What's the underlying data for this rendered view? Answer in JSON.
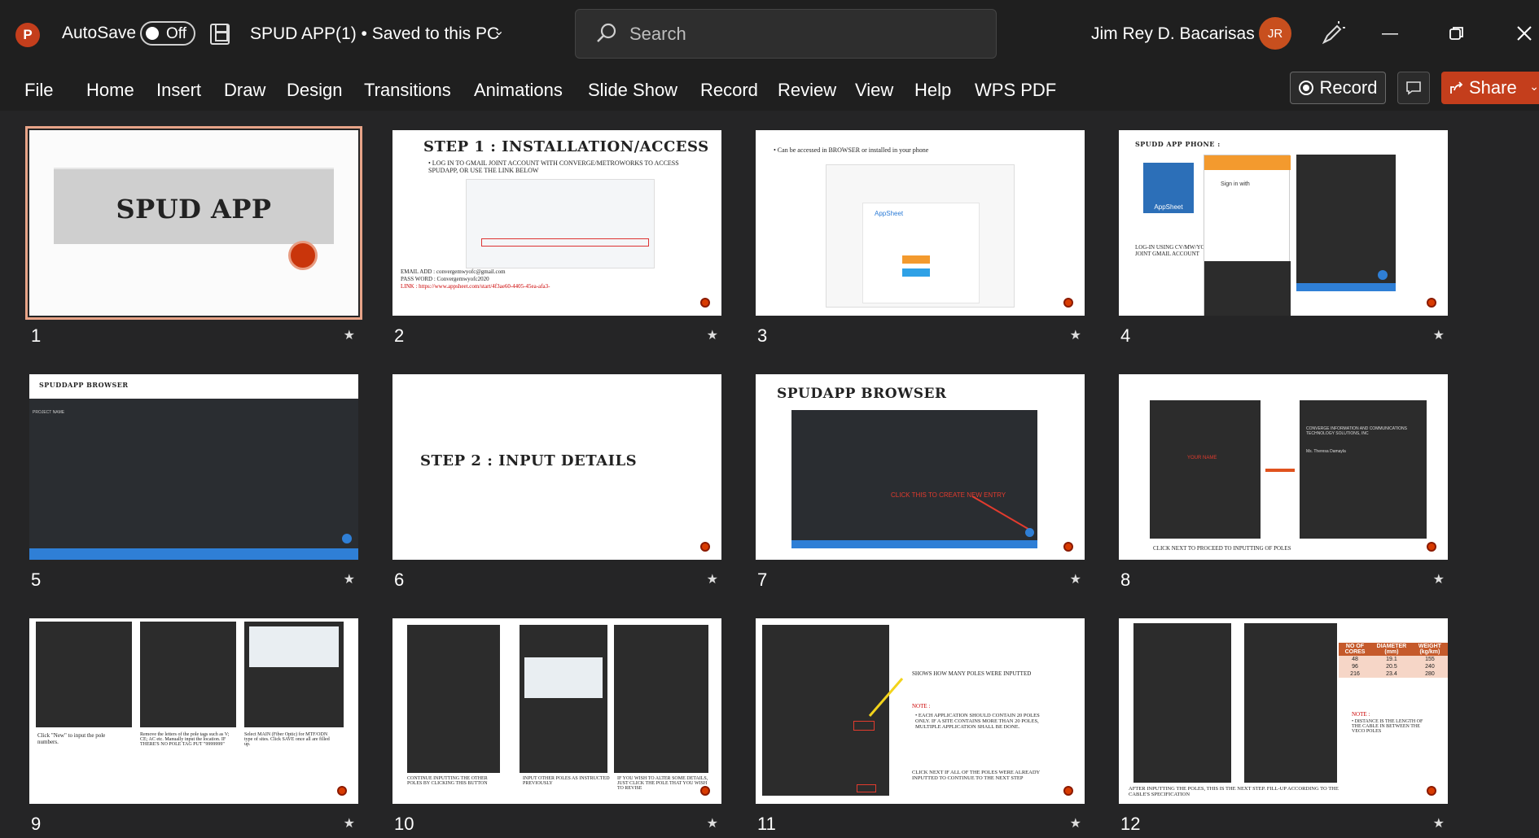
{
  "titlebar": {
    "app_letter": "P",
    "autosave_label": "AutoSave",
    "autosave_state": "Off",
    "document_title": "SPUD APP(1) • Saved to this PC",
    "search_placeholder": "Search",
    "user_name": "Jim Rey D. Bacarisas",
    "user_initials": "JR"
  },
  "menu": {
    "items": [
      "File",
      "Home",
      "Insert",
      "Draw",
      "Design",
      "Transitions",
      "Animations",
      "Slide Show",
      "Record",
      "Review",
      "View",
      "Help",
      "WPS PDF"
    ],
    "record_button": "Record",
    "share_button": "Share"
  },
  "slides": [
    {
      "number": "1",
      "selected": true,
      "title": "SPUD APP"
    },
    {
      "number": "2",
      "title": "STEP 1 : INSTALLATION/ACCESS",
      "bullet": "• LOG IN TO GMAIL JOINT ACCOUNT WITH CONVERGE/METROWORKS TO ACCESS SPUDAPP, OR USE THE LINK BELOW",
      "email_line": "EMAIL ADD : convergemwyofc@gmail.com",
      "password_line": "PASS WORD : Convergemwyofc2020",
      "link_line": "LINK : https://www.appsheet.com/start/4f3ae60-4405-45ea-afa3-"
    },
    {
      "number": "3",
      "bullet": "• Can be accessed in BROWSER or installed in your phone",
      "appsheet_label": "AppSheet"
    },
    {
      "number": "4",
      "title": "SPUDD APP PHONE :",
      "appsheet_label": "AppSheet",
      "login_note": "LOG-IN USING CV/MW/YOFC JOINT GMAIL ACCOUNT",
      "signin_label": "Sign in with"
    },
    {
      "number": "5",
      "title": "SPUDDAPP BROWSER",
      "field_label": "PROJECT NAME"
    },
    {
      "number": "6",
      "title": "STEP 2 : INPUT DETAILS"
    },
    {
      "number": "7",
      "title": "SPUDAPP BROWSER",
      "callout": "CLICK THIS TO CREATE NEW ENTRY"
    },
    {
      "number": "8",
      "footer": "CLICK NEXT TO PROCEED TO INPUTTING OF POLES",
      "company_label": "CONVERGE INFORMATION AND COMMUNICATIONS TECHNOLOGY SOLUTIONS, INC",
      "requester": "Ms. Theresa Damayla",
      "your_name": "YOUR NAME"
    },
    {
      "number": "9",
      "note_left": "Click \"New\" to input the pole numbers.",
      "note_mid": "Remove the letters of the pole tags such as V; CE; AC etc. Manually input the location. IF THERE'S NO POLE TAG PUT \"9999999\"",
      "note_right": "Select MAIN (Fiber Optic) for MTF/ODN type of sites. Click SAVE once all are filled up."
    },
    {
      "number": "10",
      "note_left": "CONTINUE INPUTTING THE OTHER POLES BY CLICKING THIS BUTTON",
      "note_mid": "INPUT OTHER POLES AS INSTRUCTED PREVIOUSLY",
      "note_right": "IF YOU WISH TO ALTER SOME DETAILS, JUST CLICK THE POLE THAT YOU WISH TO REVISE"
    },
    {
      "number": "11",
      "header_note": "SHOWS HOW MANY POLES WERE INPUTTED",
      "note_title": "NOTE :",
      "note_body": "• EACH APPLICATION SHOULD CONTAIN 20 POLES ONLY. IF A SITE CONTAINS MORE THAN 20 POLES, MULTIPLE APPLICATION SHALL BE DONE.",
      "footer": "CLICK NEXT IF ALL OF THE POLES WERE ALREADY INPUTTED TO CONTINUE TO THE NEXT STEP"
    },
    {
      "number": "12",
      "footer": "AFTER INPUTTING THE POLES, THIS IS THE NEXT STEP. FILL-UP ACCORDING TO THE CABLE'S SPECIFICATION",
      "note_title": "NOTE :",
      "note_body": "• DISTANCE IS THE LENGTH OF THE CABLE IN BETWEEN THE VECO POLES",
      "table": {
        "headers": [
          "NO OF CORES",
          "DIAMETER (mm)",
          "WEIGHT (kg/km)"
        ],
        "rows": [
          [
            "48",
            "19.1",
            "155"
          ],
          [
            "96",
            "20.5",
            "240"
          ],
          [
            "216",
            "23.4",
            "280"
          ]
        ]
      }
    }
  ],
  "colors": {
    "accent": "#c43e1c",
    "background": "#252526",
    "titlebar": "#1f1f1f"
  }
}
